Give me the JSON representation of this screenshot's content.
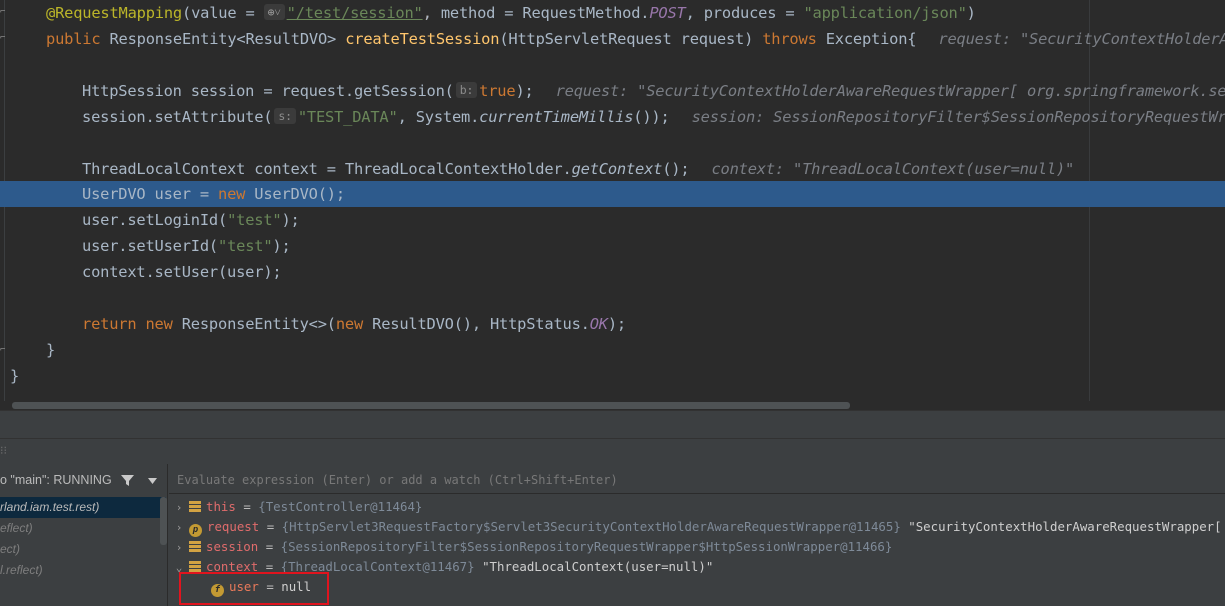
{
  "editor": {
    "lines": {
      "l1_annotation": "@RequestMapping",
      "l1_open": "(value = ",
      "l1_globe": "⊕˅",
      "l1_path": "\"/test/session\"",
      "l1_mid": ", method = RequestMethod.",
      "l1_post": "POST",
      "l1_comma": ", produces = ",
      "l1_json": "\"application/json\"",
      "l1_close": ")",
      "l2_public": "public ",
      "l2_type": "ResponseEntity<ResultDVO> ",
      "l2_method": "createTestSession",
      "l2_params": "(HttpServletRequest request) ",
      "l2_throws": "throws ",
      "l2_exc": "Exception{",
      "l2_hint": "request: \"SecurityContextHolderAw",
      "l3_code1": "HttpSession session = request.getSession(",
      "l3_phint": "b:",
      "l3_true": "true",
      "l3_end": ");",
      "l3_hint": "request: \"SecurityContextHolderAwareRequestWrapper[ org.springframework.sec",
      "l4_code1": "session.setAttribute(",
      "l4_phint": "s:",
      "l4_str": "\"TEST_DATA\"",
      "l4_mid": ", System.",
      "l4_millis": "currentTimeMillis",
      "l4_end": "());",
      "l4_hint": "session: SessionRepositoryFilter$SessionRepositoryRequestWra",
      "l5_code1": "ThreadLocalContext context = ThreadLocalContextHolder.",
      "l5_get": "getContext",
      "l5_end": "();",
      "l5_hint": "context: \"ThreadLocalContext(user=null)\"",
      "l6_code1": "UserDVO user = ",
      "l6_new": "new ",
      "l6_end": "UserDVO();",
      "l7_code1": "user.setLoginId(",
      "l7_str": "\"test\"",
      "l7_end": ");",
      "l8_code1": "user.setUserId(",
      "l8_str": "\"test\"",
      "l8_end": ");",
      "l9_code1": "context.setUser(user);",
      "l10_return": "return ",
      "l10_new": "new ",
      "l10_mid": "ResponseEntity<>(",
      "l10_new2": "new ",
      "l10_mid2": "ResultDVO(), HttpStatus.",
      "l10_ok": "OK",
      "l10_end": ");",
      "l11": "}",
      "l12": "}"
    }
  },
  "debugger": {
    "thread_selector": "o \"main\": RUNNING",
    "eval_placeholder": "Evaluate expression (Enter) or add a watch (Ctrl+Shift+Enter)",
    "frames": [
      "rland.iam.test.rest)",
      "eflect)",
      "ect)",
      "l.reflect)"
    ],
    "variables": [
      {
        "name": "this",
        "type": "{TestController@11464}",
        "value": ""
      },
      {
        "name": "request",
        "type": "{HttpServlet3RequestFactory$Servlet3SecurityContextHolderAwareRequestWrapper@11465}",
        "value": "\"SecurityContextHolderAwareRequestWrapper[ org.springframework.security.web.head"
      },
      {
        "name": "session",
        "type": "{SessionRepositoryFilter$SessionRepositoryRequestWrapper$HttpSessionWrapper@11466}",
        "value": ""
      },
      {
        "name": "context",
        "type": "{ThreadLocalContext@11467}",
        "value": "\"ThreadLocalContext(user=null)\""
      },
      {
        "name": "user",
        "type": "",
        "value": "null"
      }
    ],
    "eq": "=",
    "field_badge": "f",
    "param_badge": "p"
  },
  "colors": {
    "editor_bg": "#2b2b2b",
    "execution_line": "#2d5a8c",
    "keyword": "#cc7832",
    "string": "#6a8759",
    "annotation": "#bbb529",
    "highlight_box": "#e0141e"
  }
}
